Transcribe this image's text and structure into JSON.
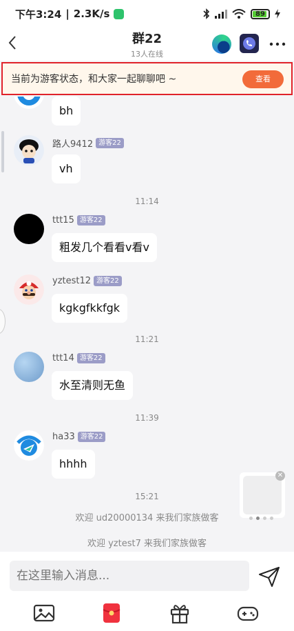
{
  "status": {
    "time": "下午3:24",
    "speed": "2.3K/s",
    "battery": "89",
    "battery_level": 0.89
  },
  "header": {
    "back_icon": "chevron-left-icon",
    "title": "群22",
    "subtitle": "13人在线",
    "edge_icon": "edge-browser-icon",
    "call_icon": "phone-call-icon",
    "more_icon": "more-dots-icon"
  },
  "banner": {
    "text": "当前为游客状态，和大家一起聊聊吧 ~",
    "button": "查看"
  },
  "messages": [
    {
      "user": "",
      "badge": "",
      "text": "bh"
    },
    {
      "user": "路人9412",
      "badge": "游客22",
      "text": "vh"
    },
    {
      "user": "ttt15",
      "badge": "游客22",
      "text": "粗发几个看看v看v"
    },
    {
      "user": "yztest12",
      "badge": "游客22",
      "text": "kgkgfkkfgk"
    },
    {
      "user": "ttt14",
      "badge": "游客22",
      "text": "水至清则无鱼"
    },
    {
      "user": "ha33",
      "badge": "游客22",
      "text": "hhhh"
    }
  ],
  "timestamps": [
    "11:14",
    "11:21",
    "11:39",
    "15:21"
  ],
  "system_messages": [
    "欢迎 ud20000134 来我们家族做客",
    "欢迎 yztest7 来我们家族做客"
  ],
  "input": {
    "placeholder": "在这里输入消息...",
    "send_icon": "send-icon"
  },
  "toolbar": [
    "image-icon",
    "red-packet-icon",
    "gift-icon",
    "gamepad-icon"
  ],
  "colors": {
    "banner_border": "#e0222a",
    "banner_bg": "#fff7ec",
    "banner_button": "#f26b3a",
    "badge": "#9b9cc7"
  }
}
